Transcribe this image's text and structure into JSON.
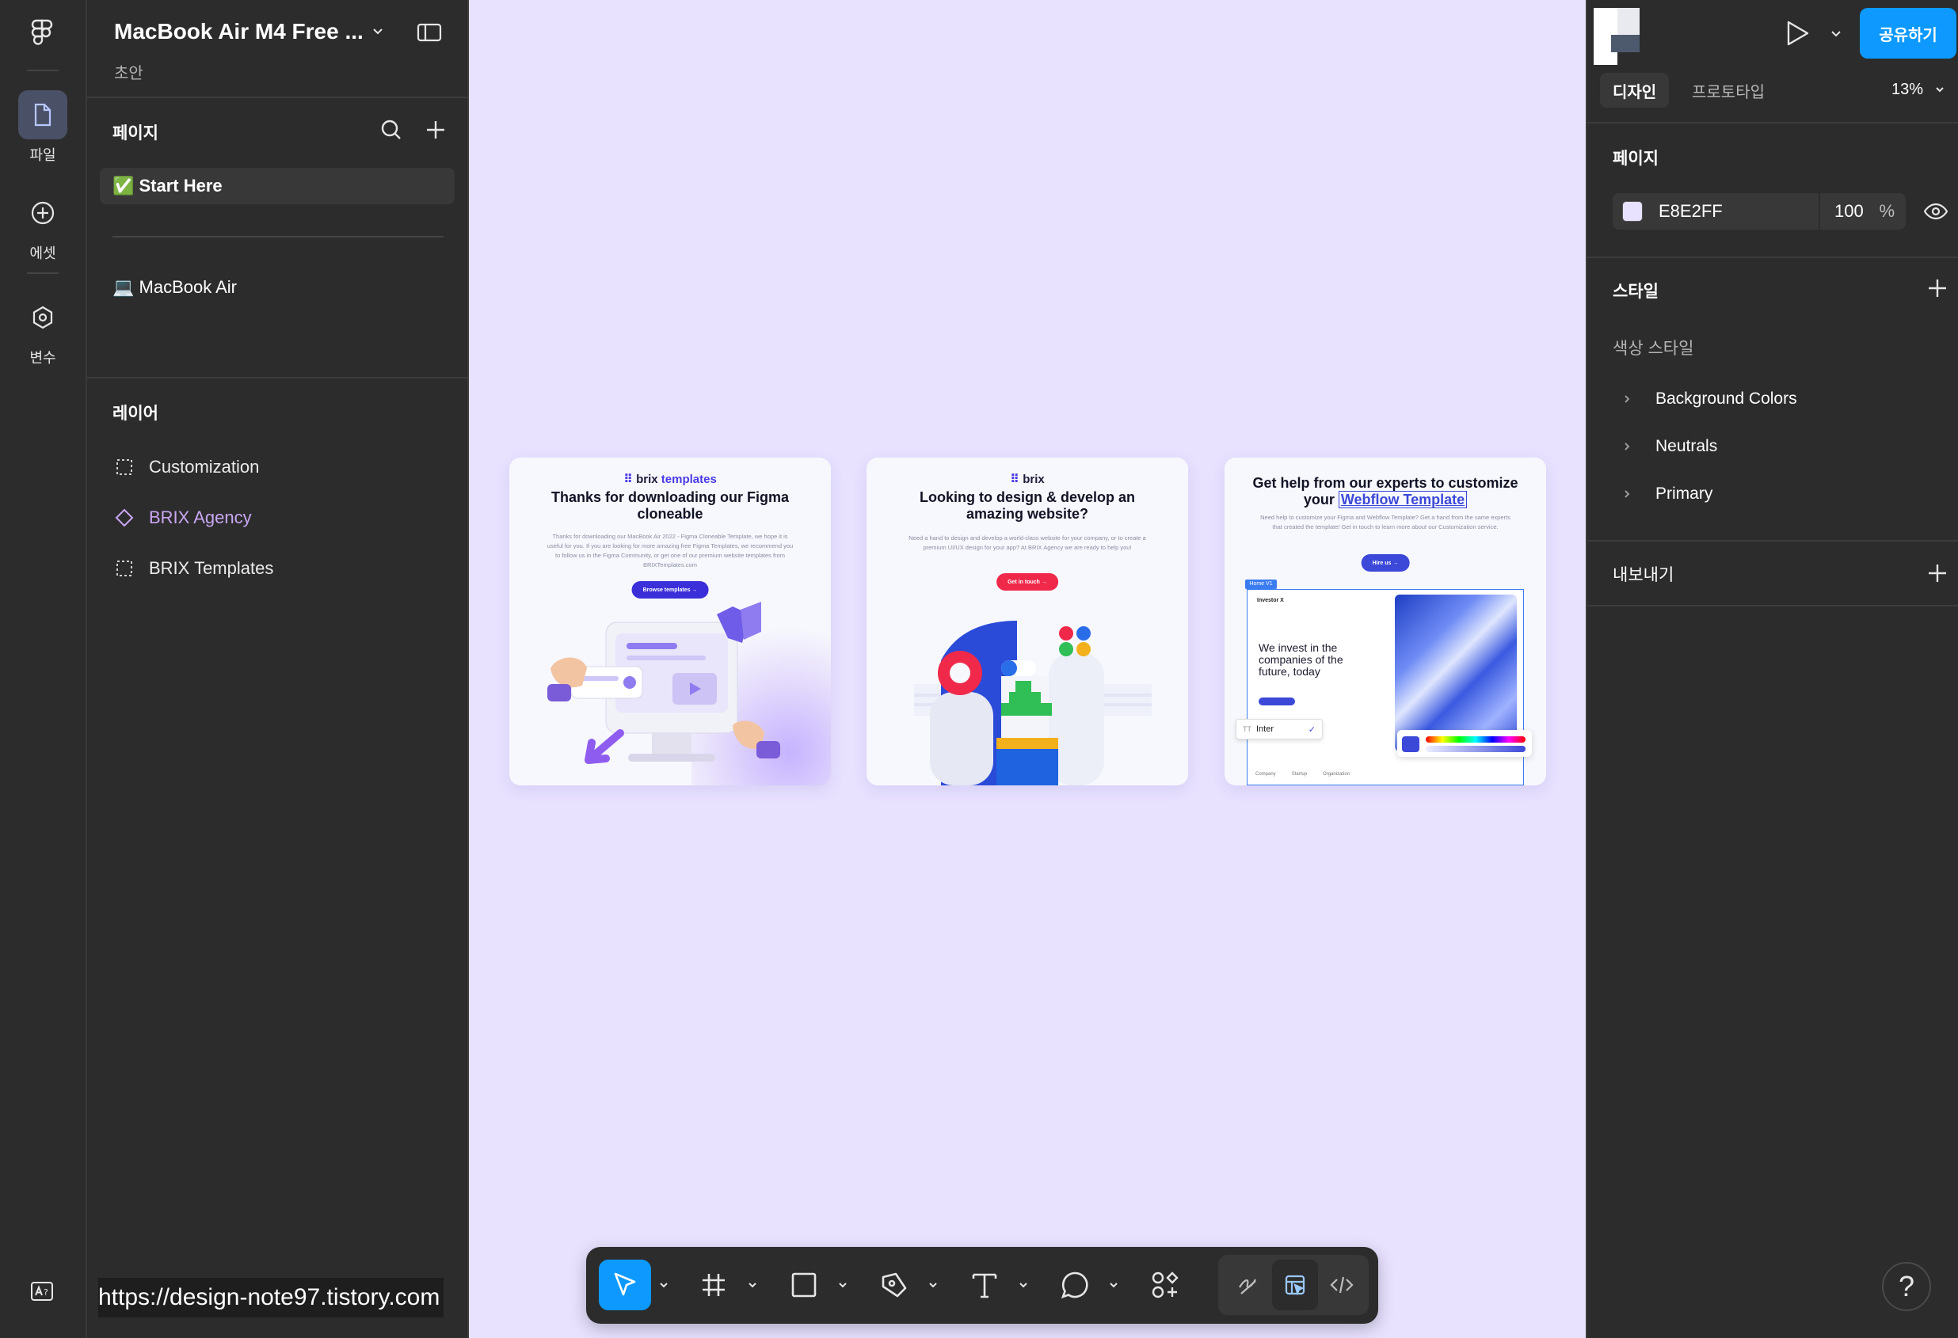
{
  "rail": {
    "items": [
      {
        "label": "파일",
        "icon": "file-icon"
      },
      {
        "label": "에셋",
        "icon": "assets-plus-icon"
      },
      {
        "label": "변수",
        "icon": "variables-hex-icon"
      }
    ],
    "bottom_icon": "ai-text-icon"
  },
  "left": {
    "file_name": "MacBook Air M4 Free ...",
    "file_status": "초안",
    "pages_title": "페이지",
    "pages": [
      {
        "label": "✅ Start Here",
        "active": true
      },
      {
        "label": "💻 MacBook Air",
        "active": false
      }
    ],
    "layers_title": "레이어",
    "layers": [
      {
        "label": "Customization",
        "type": "frame"
      },
      {
        "label": "BRIX Agency",
        "type": "component"
      },
      {
        "label": "BRIX Templates",
        "type": "frame"
      }
    ],
    "url_overlay": "https://design-note97.tistory.com"
  },
  "canvas": {
    "background": "#E8E2FF",
    "cards": [
      {
        "brand_prefix": "brix ",
        "brand_suffix": "templates",
        "title": "Thanks for downloading our Figma cloneable",
        "desc": "Thanks for downloading our MacBook Air 2022 - Figma Cloneable Template, we hope it is useful for you. If you are looking for more amazing free Figma Templates, we recommend you to follow us in the Figma Community, or get one of our premium website templates from BRIXTemplates.com",
        "button": "Browse templates →",
        "button_color": "#3b2fd9"
      },
      {
        "brand_prefix": "brix",
        "brand_suffix": "",
        "title": "Looking to design & develop an amazing website?",
        "desc": "Need a hand to design and develop a world-class website for your company, or to create a premium UI/UX design for your app? At BRIX Agency we are ready to help you!",
        "button": "Get in touch →",
        "button_color": "#f0294b"
      },
      {
        "title_part1": "Get help from our experts to customize your ",
        "title_highlight": "Webflow Template",
        "desc": "Need help to customize your Figma and Webflow Template? Get a hand from the same experts that created the template! Get in touch to learn more about our Customization service.",
        "button": "Hire us →",
        "button_color": "#3b48d8",
        "frame_tag": "Home V1",
        "mock_brand": "Investor X",
        "mock_heading": "We invest in the companies of the future, today",
        "font_chip": "Inter",
        "mock_footer": [
          "Company",
          "Startup",
          "Organization"
        ]
      }
    ]
  },
  "toolbar": {
    "tools": [
      "move-tool",
      "frame-tool",
      "rectangle-tool",
      "pen-tool",
      "text-tool",
      "comment-tool",
      "actions-tool"
    ],
    "modes": [
      "draw-mode",
      "design-mode",
      "dev-mode"
    ]
  },
  "right": {
    "share_label": "공유하기",
    "tabs": [
      {
        "label": "디자인",
        "active": true
      },
      {
        "label": "프로토타입",
        "active": false
      }
    ],
    "zoom": "13%",
    "page_section": "페이지",
    "page_fill_hex": "E8E2FF",
    "page_fill_color": "#E8E2FF",
    "page_opacity": "100",
    "page_opacity_unit": "%",
    "styles_section": "스타일",
    "color_styles_title": "색상 스타일",
    "color_styles": [
      "Background Colors",
      "Neutrals",
      "Primary"
    ],
    "export_section": "내보내기",
    "help_label": "?"
  },
  "colors": {
    "accent": "#0d99ff",
    "panel": "#2c2c2c",
    "component": "#c9a7f2"
  }
}
